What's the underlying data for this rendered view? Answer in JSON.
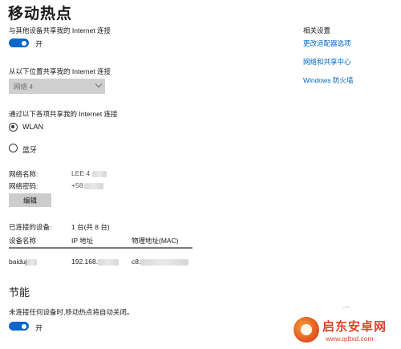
{
  "page": {
    "title": "移动热点"
  },
  "share": {
    "label": "与其他设备共享我的 Internet 连接",
    "toggle_state": "开"
  },
  "share_from": {
    "label": "从以下位置共享我的 Internet 连接",
    "selected": "网络 4"
  },
  "share_over": {
    "label": "通过以下各项共享我的 Internet 连接",
    "options": [
      "WLAN",
      "蓝牙"
    ],
    "selected": "WLAN"
  },
  "network": {
    "name_label": "网络名称:",
    "name_value": "LEE 4",
    "password_label": "网络密码:",
    "password_value": "+58",
    "edit_label": "编辑"
  },
  "connected": {
    "label": "已连接的设备:",
    "count": "1 台(共 8 台)",
    "columns": [
      "设备名称",
      "IP 地址",
      "物理地址(MAC)"
    ],
    "rows": [
      {
        "name": "baiduj",
        "ip": "192.168.",
        "mac": "c8:"
      }
    ]
  },
  "power": {
    "title": "节能",
    "description": "未连接任何设备时,移动热点将自动关闭。",
    "toggle_state": "开"
  },
  "related": {
    "title": "相关设置",
    "links": [
      "更改适配器选项",
      "网络和共享中心",
      "Windows 防火墙"
    ]
  },
  "watermark": {
    "text": "启东安卓网",
    "url": "www.qdtxd.com"
  },
  "colors": {
    "accent": "#0a66c9",
    "link": "#0067c0",
    "watermark": "#d9462a"
  }
}
